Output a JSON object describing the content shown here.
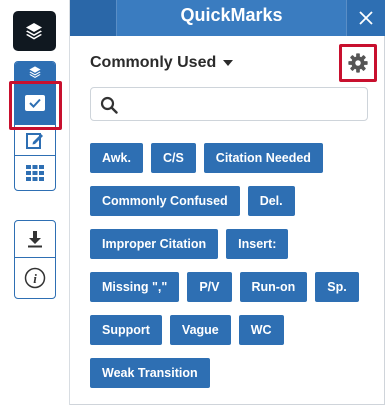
{
  "header": {
    "title": "QuickMarks"
  },
  "main": {
    "category_label": "Commonly Used",
    "search_placeholder": "",
    "chips": [
      [
        "Awk.",
        "C/S",
        "Citation Needed"
      ],
      [
        "Commonly Confused",
        "Del."
      ],
      [
        "Improper Citation",
        "Insert:"
      ],
      [
        "Missing \",\"",
        "P/V",
        "Run-on",
        "Sp."
      ],
      [
        "Support",
        "Vague",
        "WC"
      ],
      [
        "Weak Transition"
      ]
    ]
  },
  "colors": {
    "accent": "#2e6fb3",
    "highlight": "#c8102e",
    "rail_dark": "#101820"
  },
  "icons": {
    "rail": [
      "layers-icon",
      "layers-icon",
      "check-icon",
      "edit-icon",
      "grid-icon",
      "download-icon",
      "info-icon"
    ],
    "header_close": "close-icon",
    "settings": "gear-icon",
    "search": "search-icon",
    "dropdown": "caret-down-icon"
  }
}
